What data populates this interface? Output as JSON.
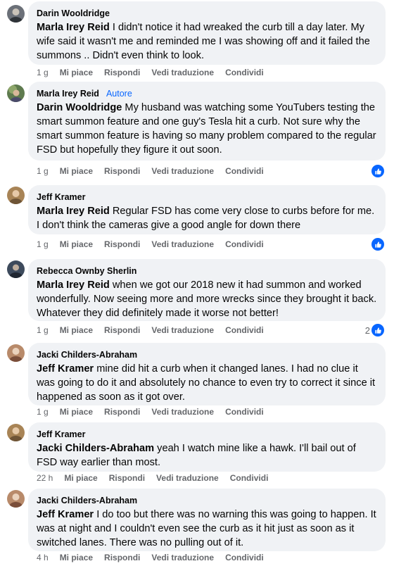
{
  "colors": {
    "bubble": "#f0f2f5",
    "link": "#0866ff",
    "meta": "#65676b"
  },
  "actions": {
    "like": "Mi piace",
    "reply": "Rispondi",
    "translate": "Vedi traduzione",
    "share": "Condividi"
  },
  "comments": [
    {
      "author": "Darin Wooldridge",
      "badge": "",
      "mention": "Marla Irey Reid",
      "text": "I didn't notice it had wreaked the curb till a day later. My wife said it wasn't me and reminded me I was showing off and it failed the summons .. Didn't even think to look.",
      "time": "1 g",
      "reaction_count": "",
      "avatar_color": "#6b7078"
    },
    {
      "author": "Marla Irey Reid",
      "badge": "Autore",
      "mention": "Darin Wooldridge",
      "text": "My husband was watching some YouTubers testing the smart summon feature and one guy's Tesla hit a curb. Not sure why the smart summon feature is having so many problem compared to the regular FSD but hopefully they figure it out soon.",
      "time": "1 g",
      "reaction_count": "",
      "avatar_color": "#5e7a4e"
    },
    {
      "author": "Jeff Kramer",
      "badge": "",
      "mention": "Marla Irey Reid",
      "text": "Regular FSD has come very close to curbs before for me. I don't think the cameras give a good angle for down there",
      "time": "1 g",
      "reaction_count": "",
      "avatar_color": "#a88456"
    },
    {
      "author": "Rebecca Ownby Sherlin",
      "badge": "",
      "mention": "Marla Irey Reid",
      "text": "when we got our 2018 new it had summon and worked wonderfully. Now seeing more and more wrecks since they brought it back. Whatever they did definitely made it worse not better!",
      "time": "1 g",
      "reaction_count": "2",
      "avatar_color": "#3d4a5c"
    },
    {
      "author": "Jacki Childers-Abraham",
      "badge": "",
      "mention": "Jeff Kramer",
      "text": "mine did hit a curb when it changed lanes. I had no clue it was going to do it and absolutely no chance to even try to correct it since it happened as soon as it got over.",
      "time": "1 g",
      "reaction_count": "",
      "avatar_color": "#b88a6a"
    },
    {
      "author": "Jeff Kramer",
      "badge": "",
      "mention": "Jacki Childers-Abraham",
      "text": "yeah I watch mine like a hawk. I'll bail out of FSD way earlier than most.",
      "time": "22 h",
      "reaction_count": "",
      "avatar_color": "#a88456"
    },
    {
      "author": "Jacki Childers-Abraham",
      "badge": "",
      "mention": "Jeff Kramer",
      "text": "I do too but there was no warning this was going to happen. It was at night and I couldn't even see the curb as it hit just as soon as it switched lanes. There was no pulling out of it.",
      "time": "4 h",
      "reaction_count": "",
      "avatar_color": "#b88a6a"
    }
  ]
}
